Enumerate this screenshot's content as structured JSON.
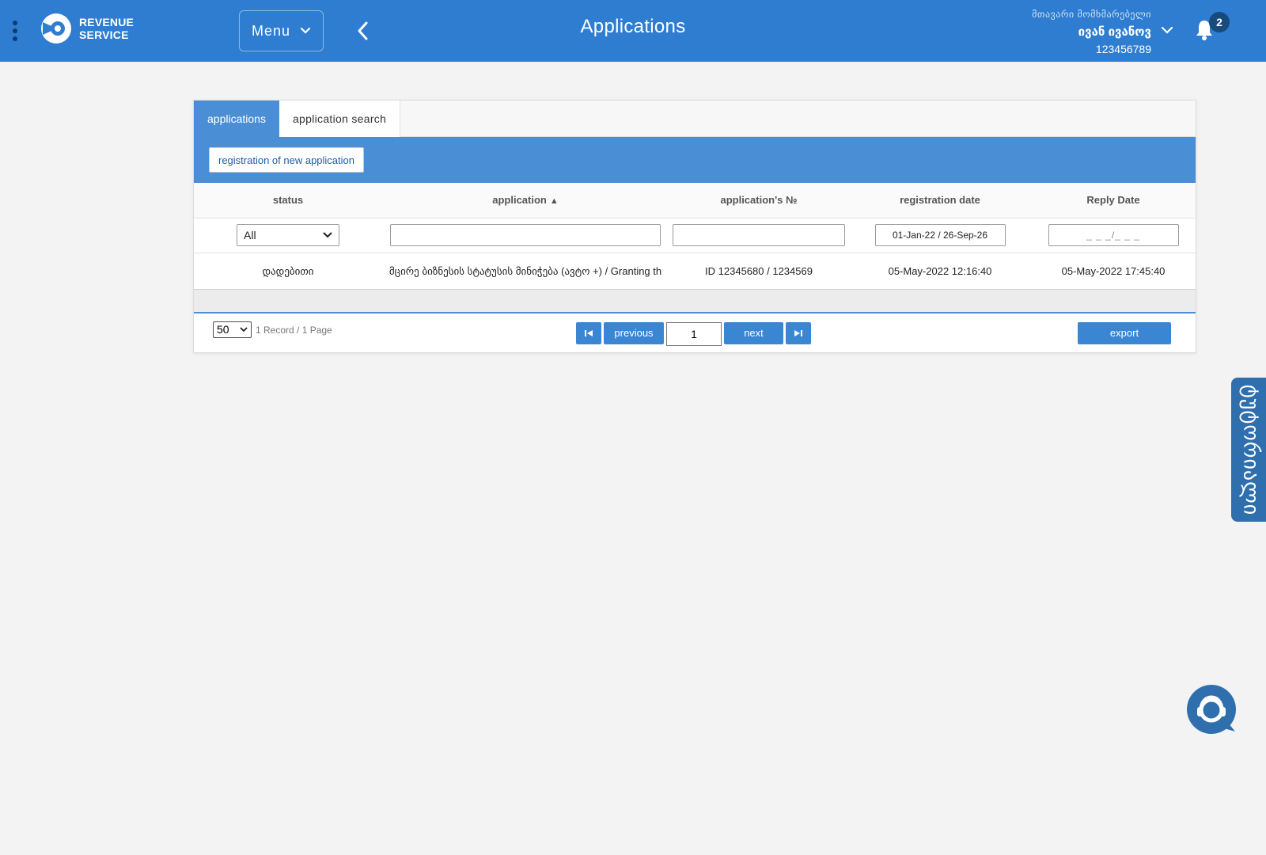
{
  "header": {
    "logo_line1": "REVENUE",
    "logo_line2": "SERVICE",
    "menu_label": "Menu",
    "title": "Applications",
    "user_role": "მთავარი მომხმარებელი",
    "user_name": "ივან ივანოვ",
    "user_id": "123456789",
    "notification_count": "2"
  },
  "tabs": [
    {
      "label": "applications",
      "active": true
    },
    {
      "label": "application search",
      "active": false
    }
  ],
  "toolbar": {
    "new_application_label": "registration of new application"
  },
  "table": {
    "columns": [
      "status",
      "application",
      "application's №",
      "registration date",
      "Reply Date"
    ],
    "sort_indicator": "▲",
    "filters": {
      "status_selected": "All",
      "application": "",
      "application_no": "",
      "registration_date": "01-Jan-22 / 26-Sep-26",
      "reply_date": "_ _ _/_ _ _"
    },
    "rows": [
      {
        "status": "დადებითი",
        "application": "მცირე ბიზნესის სტატუსის მინიჭება (ავტო +) / Granting th",
        "application_no": "ID 12345680 / 1234569",
        "registration_date": "05-May-2022 12:16:40",
        "reply_date": "05-May-2022 17:45:40"
      }
    ]
  },
  "pager": {
    "page_size": "50",
    "records_info": "1 Record / 1 Page",
    "previous_label": "previous",
    "current_page": "1",
    "next_label": "next",
    "export_label": "export"
  },
  "side_tab_label": "ტუტორიალი",
  "colors": {
    "header_bg": "#2e7dd1",
    "accent": "#4a8fd6",
    "button": "#3b86d3",
    "side_tab": "#2f6fae"
  },
  "icons": [
    "kebab-icon",
    "logo-icon",
    "chevron-down-icon",
    "back-arrow-icon",
    "bell-icon",
    "first-page-icon",
    "last-page-icon",
    "chat-support-icon"
  ]
}
